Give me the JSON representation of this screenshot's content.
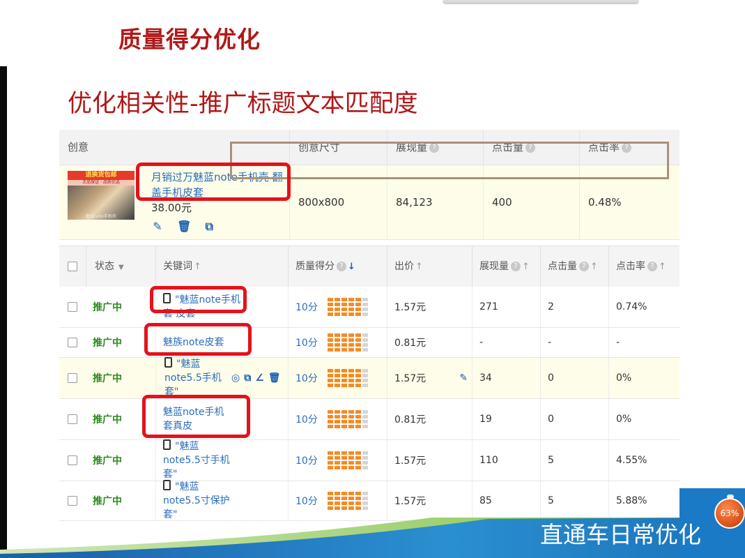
{
  "slide": {
    "title": "质量得分优化",
    "subtitle": "优化相关性-推广标题文本匹配度",
    "footer_label": "直通车日常优化",
    "badge_percent": "63%"
  },
  "ad_table": {
    "headers": [
      "创意",
      "创意尺寸",
      "展现量",
      "点击量",
      "点击率"
    ],
    "row": {
      "thumbnail_banner": "退换货包邮",
      "thumbnail_sub": "正品保证 · 品质优选",
      "thumbnail_footer": "魅蓝note手机壳",
      "title": "月销过万魅蓝note手机壳 翻盖手机皮套",
      "price": "38.00元",
      "size": "800x800",
      "impressions": "84,123",
      "clicks": "400",
      "ctr": "0.48%"
    }
  },
  "keyword_table": {
    "headers": {
      "status": "状态",
      "keyword": "关键词",
      "quality": "质量得分",
      "bid": "出价",
      "impressions": "展现量",
      "clicks": "点击量",
      "ctr": "点击率"
    },
    "rows": [
      {
        "status": "推广中",
        "keyword": "\"魅蓝note手机套 皮套",
        "mobile": true,
        "quality": "10分",
        "bid": "1.57元",
        "impressions": "271",
        "clicks": "2",
        "ctr": "0.74%"
      },
      {
        "status": "推广中",
        "keyword": "魅族note皮套",
        "mobile": false,
        "quality": "10分",
        "bid": "0.81元",
        "impressions": "-",
        "clicks": "-",
        "ctr": "-"
      },
      {
        "status": "推广中",
        "keyword": "\"魅蓝note5.5手机套\"",
        "mobile": true,
        "quality": "10分",
        "bid": "1.57元",
        "impressions": "34",
        "clicks": "0",
        "ctr": "0%"
      },
      {
        "status": "推广中",
        "keyword": "魅蓝note手机套真皮",
        "mobile": false,
        "quality": "10分",
        "bid": "0.81元",
        "impressions": "19",
        "clicks": "0",
        "ctr": "0%"
      },
      {
        "status": "推广中",
        "keyword": "\"魅蓝note5.5寸手机套\"",
        "mobile": true,
        "quality": "10分",
        "bid": "1.57元",
        "impressions": "110",
        "clicks": "5",
        "ctr": "4.55%"
      },
      {
        "status": "推广中",
        "keyword": "\"魅蓝note5.5寸保护套\"",
        "mobile": true,
        "quality": "10分",
        "bid": "1.57元",
        "impressions": "85",
        "clicks": "5",
        "ctr": "5.88%"
      }
    ]
  },
  "colors": {
    "title_red": "#b01818",
    "link_blue": "#2a6ebd",
    "status_green": "#2d8a1f",
    "quality_orange": "#f28c28",
    "highlight_red": "#e4121b"
  },
  "icons": [
    "edit-icon",
    "delete-icon",
    "preview-icon",
    "mobile-icon",
    "target-icon",
    "chart-icon",
    "pencil-icon",
    "help-icon",
    "sort-arrow-icon",
    "dropdown-caret-icon"
  ]
}
